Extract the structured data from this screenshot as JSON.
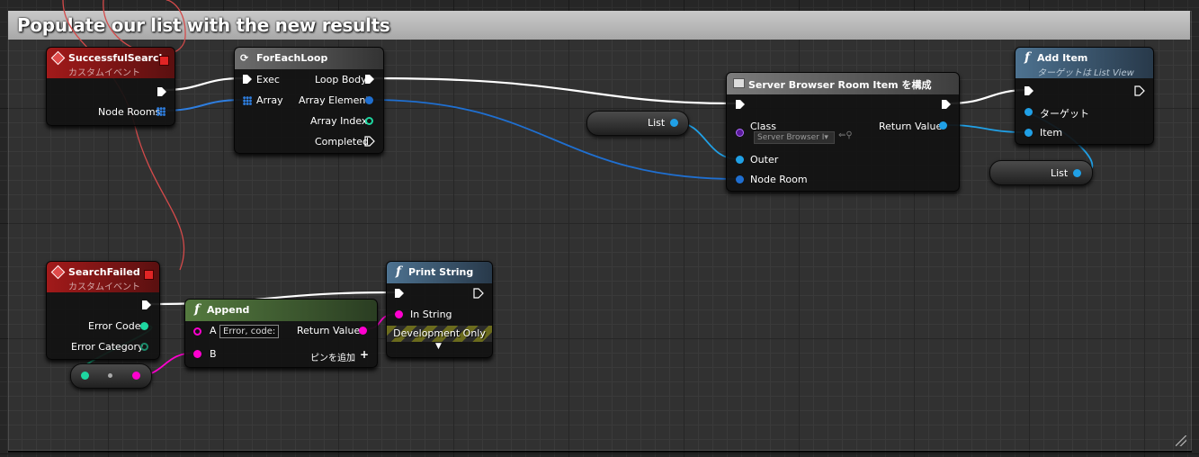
{
  "comment": {
    "title": "Populate our list with the new results"
  },
  "nodes": {
    "successful_search": {
      "title": "SuccessfulSearch",
      "subtitle": "カスタムイベント",
      "pin_node_rooms": "Node Rooms"
    },
    "foreach": {
      "title": "ForEachLoop",
      "pin_exec": "Exec",
      "pin_array": "Array",
      "pin_loop_body": "Loop Body",
      "pin_array_element": "Array Element",
      "pin_array_index": "Array Index",
      "pin_completed": "Completed"
    },
    "construct": {
      "title": "Server Browser Room Item を構成",
      "pin_class": "Class",
      "class_value": "Server Browser I▾",
      "pin_return": "Return Value",
      "pin_outer": "Outer",
      "pin_node_room": "Node Room"
    },
    "add_item": {
      "title": "Add Item",
      "subtitle": "ターゲットは List View",
      "pin_target": "ターゲット",
      "pin_item": "Item"
    },
    "search_failed": {
      "title": "SearchFailed",
      "subtitle": "カスタムイベント",
      "pin_error_code": "Error Code",
      "pin_error_category": "Error Category"
    },
    "append": {
      "title": "Append",
      "pin_a": "A",
      "a_value": "Error, code:",
      "pin_b": "B",
      "pin_return": "Return Value",
      "add_pin": "ピンを追加"
    },
    "print_string": {
      "title": "Print String",
      "pin_in_string": "In String",
      "dev_only": "Development Only"
    }
  },
  "variables": {
    "list_1": "List",
    "list_2": "List"
  },
  "colors": {
    "exec": "#ffffff",
    "object": "#20a0e6",
    "array": "#2e7ee0",
    "int": "#1ed6a0",
    "string": "#ff00d0",
    "event_header": "#a21a1a",
    "function_header": "#4d7290",
    "pure_header": "#547a3f",
    "error_wire": "#d44a4a"
  }
}
